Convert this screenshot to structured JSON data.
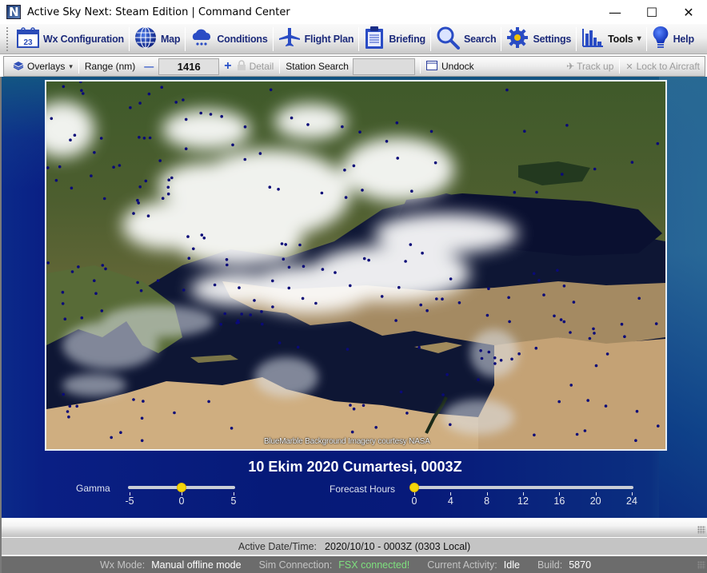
{
  "window": {
    "title": "Active Sky Next: Steam Edition | Command Center",
    "app_icon": "N",
    "controls": {
      "minimize": "—",
      "maximize": "☐",
      "close": "✕"
    }
  },
  "toolbar": {
    "items": [
      {
        "label": "Wx Configuration",
        "icon": "calendar-icon",
        "icon_text": "23"
      },
      {
        "label": "Map",
        "icon": "globe-icon"
      },
      {
        "label": "Conditions",
        "icon": "rain-cloud-icon"
      },
      {
        "label": "Flight Plan",
        "icon": "airplane-icon"
      },
      {
        "label": "Briefing",
        "icon": "clipboard-icon"
      },
      {
        "label": "Search",
        "icon": "magnifier-icon"
      },
      {
        "label": "Settings",
        "icon": "gear-icon"
      },
      {
        "label": "Tools",
        "icon": "bar-chart-icon",
        "dropdown": "▾"
      },
      {
        "label": "Help",
        "icon": "lightbulb-icon"
      }
    ]
  },
  "map_toolbar": {
    "overlays_label": "Overlays",
    "overlays_caret": "▾",
    "range_label": "Range (nm)",
    "range_minus": "—",
    "range_value": "1416",
    "range_plus": "+",
    "detail_label": "Detail",
    "station_search_label": "Station Search",
    "station_search_value": "",
    "undock_label": "Undock",
    "track_up_label": "Track up",
    "lock_aircraft_label": "Lock to Aircraft"
  },
  "map": {
    "credit": "BlueMarble Background Imagery courtesy NASA",
    "date_heading": "10 Ekim 2020 Cumartesi, 0003Z",
    "station_color": "#0a0a78"
  },
  "gamma": {
    "label": "Gamma",
    "min": -5,
    "max": 5,
    "value": 0,
    "ticks": [
      "-5",
      "0",
      "5"
    ]
  },
  "forecast": {
    "label": "Forecast Hours",
    "min": 0,
    "max": 24,
    "value": 0,
    "ticks": [
      "0",
      "4",
      "8",
      "12",
      "16",
      "20",
      "24"
    ]
  },
  "active_datetime": {
    "label": "Active Date/Time:",
    "value": "2020/10/10 - 0003Z (0303 Local)"
  },
  "status": {
    "wx_mode_label": "Wx Mode:",
    "wx_mode_value": "Manual offline mode",
    "sim_label": "Sim Connection:",
    "sim_value": "FSX connected!",
    "activity_label": "Current Activity:",
    "activity_value": "Idle",
    "build_label": "Build:",
    "build_value": "5870"
  },
  "colors": {
    "toolbar_text": "#1c2a7a",
    "slider_thumb": "#f5d60a",
    "sim_connected": "#7ee07e"
  }
}
